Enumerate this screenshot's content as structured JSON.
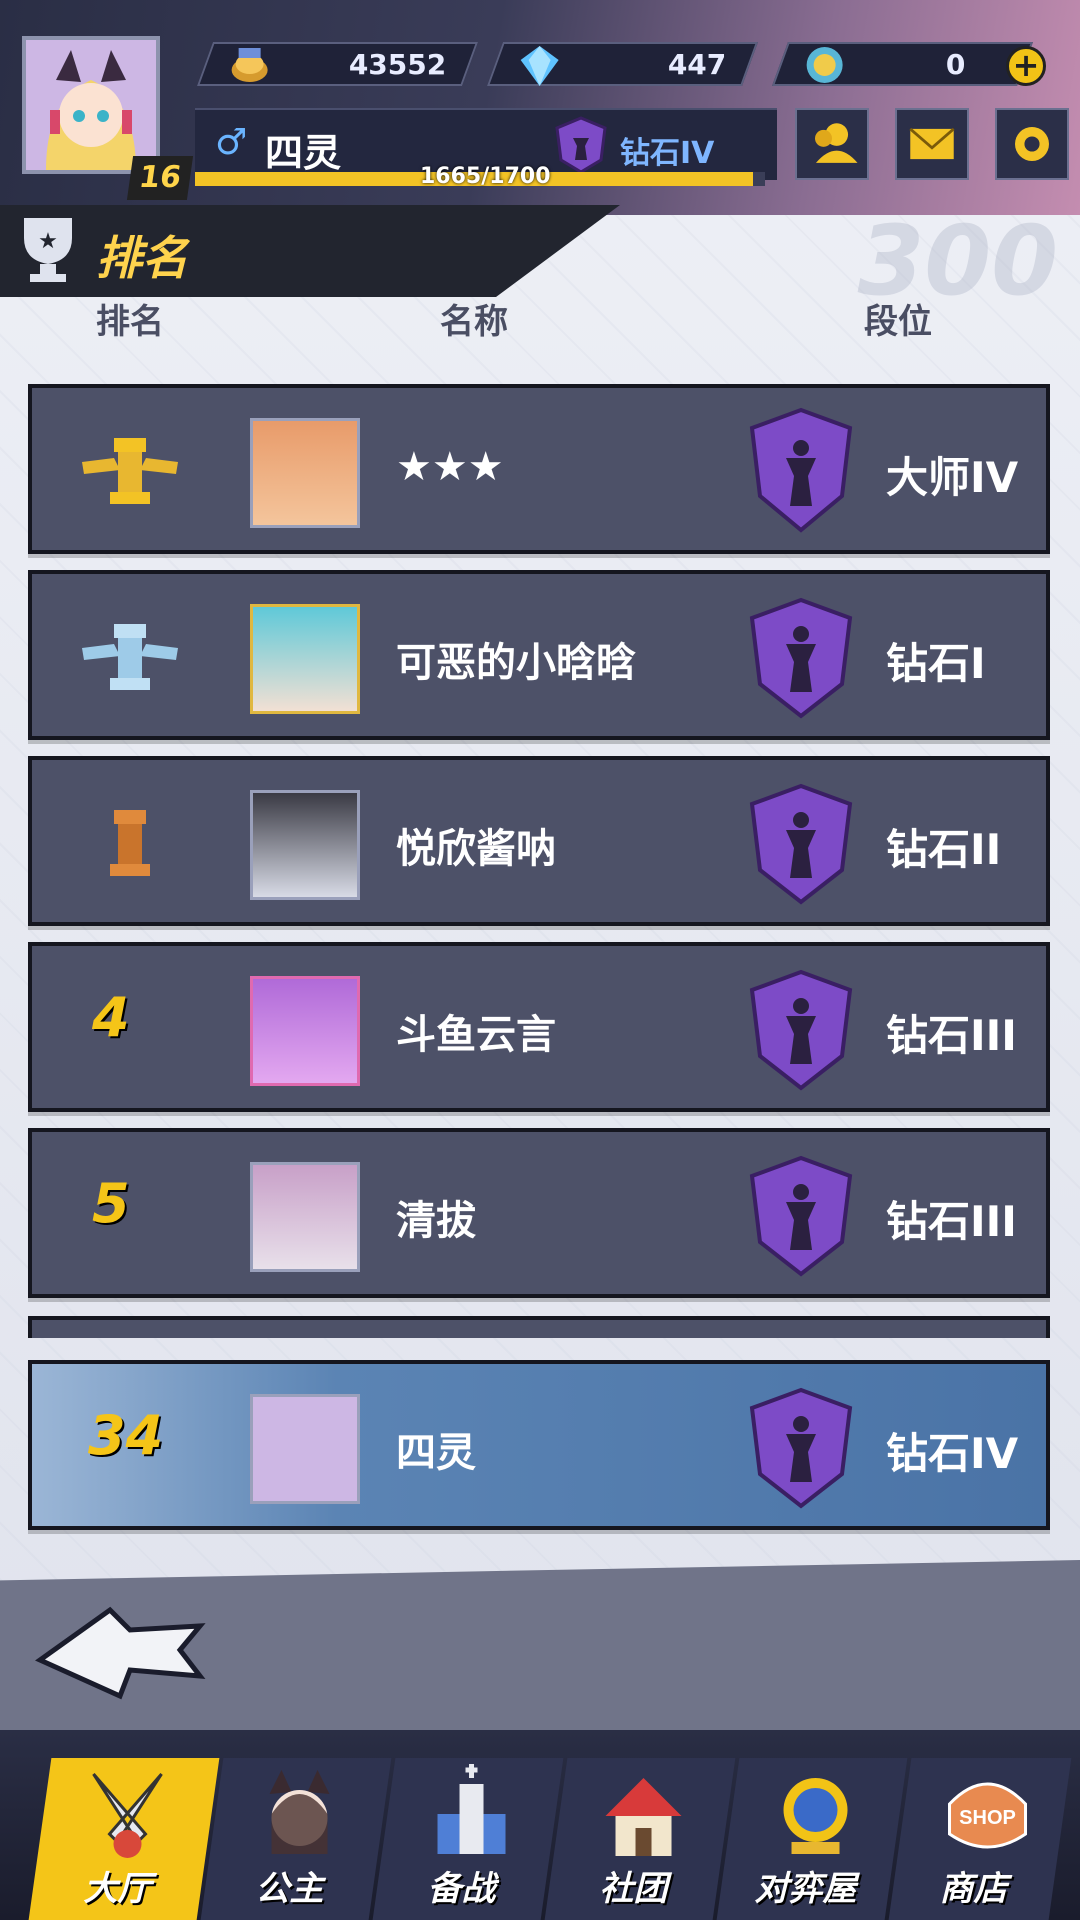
{
  "player": {
    "level": "16",
    "name": "四灵",
    "rank": "钻石IV",
    "xp": "1665/1700",
    "xp_fraction": 0.979
  },
  "resources": {
    "gold": "43552",
    "diamonds": "447",
    "coins": "0"
  },
  "section_title": "排名",
  "columns": {
    "rank": "排名",
    "name": "名称",
    "tier": "段位"
  },
  "watermark": "300",
  "rows": [
    {
      "rank": "1",
      "name": "★★★",
      "tier": "大师IV"
    },
    {
      "rank": "2",
      "name": "可恶的小晗晗",
      "tier": "钻石I"
    },
    {
      "rank": "3",
      "name": "悦欣酱呐",
      "tier": "钻石II"
    },
    {
      "rank": "4",
      "name": "斗鱼云言",
      "tier": "钻石III"
    },
    {
      "rank": "5",
      "name": "清拔",
      "tier": "钻石III"
    }
  ],
  "self_row": {
    "rank": "34",
    "name": "四灵",
    "tier": "钻石IV"
  },
  "nav": [
    {
      "label": "大厅"
    },
    {
      "label": "公主"
    },
    {
      "label": "备战"
    },
    {
      "label": "社团"
    },
    {
      "label": "对弈屋"
    },
    {
      "label": "商店"
    }
  ],
  "colors": {
    "accent": "#f4c518",
    "row_bg": "#4d5168",
    "self_row": "#4a73a6",
    "tier_shield": "#7d4bc7"
  }
}
